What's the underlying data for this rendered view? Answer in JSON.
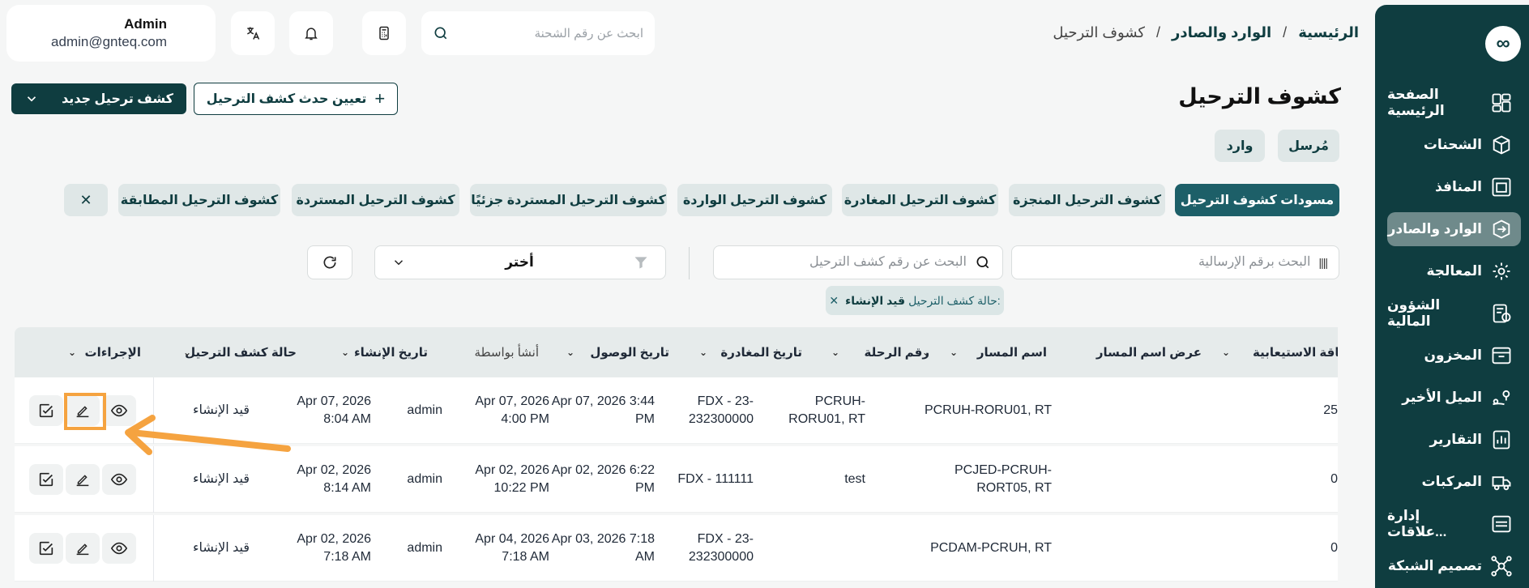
{
  "user": {
    "name": "Admin",
    "email": "admin@gnteq.com"
  },
  "header": {
    "search_placeholder": "ابحث عن رقم الشحنة"
  },
  "breadcrumb": [
    "الرئيسية",
    "الوارد والصادر",
    "كشوف الترحيل"
  ],
  "page": {
    "title": "كشوف الترحيل",
    "new_button": "كشف ترحيل جديد",
    "assign_button": "تعيين حدث كشف الترحيل"
  },
  "direction_tabs": [
    "مُرسل",
    "وارد"
  ],
  "category_tabs": [
    "مسودات كشوف الترحيل",
    "كشوف الترحيل المنجزة",
    "كشوف الترحيل المغادرة",
    "كشوف الترحيل الواردة",
    "كشوف الترحيل المستردة جزئيًا",
    "كشوف الترحيل المستردة",
    "كشوف الترحيل المطابقة"
  ],
  "filters": {
    "waybill_placeholder": "البحث برقم الإرسالية",
    "manifest_placeholder": "البحث عن رقم كشف الترحيل",
    "select_label": "أختر",
    "status_tag_label": "حالة كشف الترحيل:",
    "status_tag_value": "قيد الإنشاء"
  },
  "sidebar": {
    "items": [
      {
        "label": "الصفحة الرئيسية",
        "icon": "dashboard-icon"
      },
      {
        "label": "الشحنات",
        "icon": "package-icon"
      },
      {
        "label": "المنافذ",
        "icon": "gate-icon"
      },
      {
        "label": "الوارد والصادر",
        "icon": "inbound-outbound-icon",
        "active": true
      },
      {
        "label": "المعالجة",
        "icon": "processing-icon"
      },
      {
        "label": "الشؤون المالية",
        "icon": "finance-icon"
      },
      {
        "label": "المخزون",
        "icon": "inventory-icon"
      },
      {
        "label": "الميل الأخير",
        "icon": "last-mile-icon"
      },
      {
        "label": "التقارير",
        "icon": "reports-icon"
      },
      {
        "label": "المركبات",
        "icon": "vehicles-icon"
      },
      {
        "label": "إدارة علاقات...",
        "icon": "crm-icon"
      },
      {
        "label": "تصميم الشبكة",
        "icon": "network-icon"
      }
    ]
  },
  "table": {
    "columns": [
      "طاقة الاستيعابية",
      "عرض اسم المسار",
      "اسم المسار",
      "رقم الرحلة",
      "تاريخ المغادرة",
      "تاريخ الوصول",
      "أنشأ بواسطة",
      "تاريخ الإنشاء",
      "حالة كشف الترحيل",
      "الإجراءات"
    ],
    "rows": [
      {
        "capacity": "25",
        "route_display": "PCRUH-RORU01, RT",
        "route_name": "PCRUH-\nRORU01, RT",
        "flight": "FDX - 23-\n232300000",
        "departure": "Apr 07, 2026 3:44\nPM",
        "arrival": "Apr 07, 2026\n4:00 PM",
        "created_by": "admin",
        "created_at": "Apr 07, 2026\n8:04 AM",
        "status": "قيد الإنشاء"
      },
      {
        "capacity": "0",
        "route_display": "PCJED-PCRUH-\nRORT05, RT",
        "route_name": "test",
        "flight": "FDX - 111111",
        "departure": "Apr 02, 2026 6:22\nPM",
        "arrival": "Apr 02, 2026\n10:22 PM",
        "created_by": "admin",
        "created_at": "Apr 02, 2026\n8:14 AM",
        "status": "قيد الإنشاء"
      },
      {
        "capacity": "0",
        "route_display": "PCDAM-PCRUH, RT",
        "route_name": "",
        "flight": "FDX - 23-\n232300000",
        "departure": "Apr 03, 2026 7:18\nAM",
        "arrival": "Apr 04, 2026\n7:18 AM",
        "created_by": "admin",
        "created_at": "Apr 02, 2026\n7:18 AM",
        "status": "قيد الإنشاء"
      }
    ]
  },
  "colors": {
    "primary": "#0f3d40",
    "active_tab": "#1d5f68",
    "highlight": "#f5a340"
  }
}
